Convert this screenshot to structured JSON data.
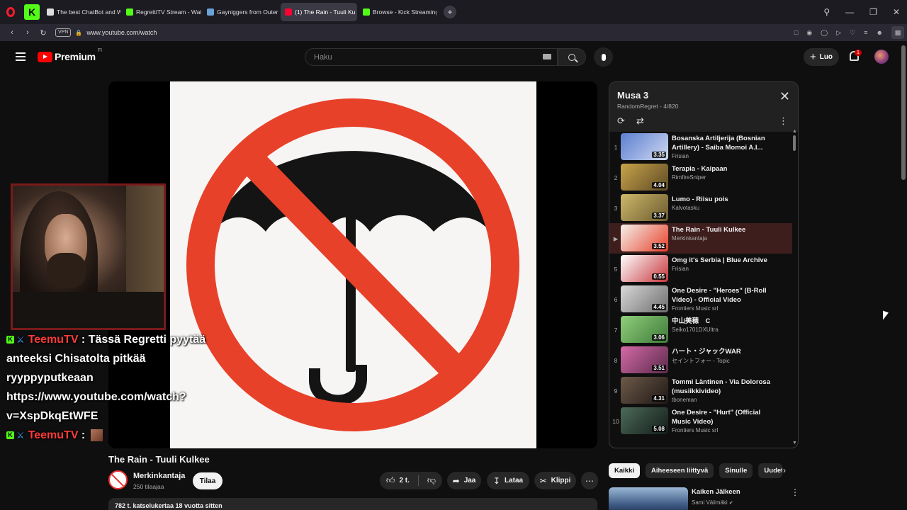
{
  "browser": {
    "tabs": [
      {
        "label": "The best ChatBot and Wid",
        "color": "#dddddd"
      },
      {
        "label": "RegrettiTV Stream - Watc",
        "color": "#53fc18"
      },
      {
        "label": "Gayniggers from Outer Sp",
        "color": "#6aa3d8"
      },
      {
        "label": "(1) The Rain - Tuuli Ku",
        "color": "#ff0033"
      },
      {
        "label": "Browse - Kick Streaming",
        "color": "#53fc18"
      }
    ],
    "url": "www.youtube.com/watch",
    "vpn_label": "VPN"
  },
  "youtube": {
    "brand": "Premium",
    "region": "FI",
    "search_placeholder": "Haku",
    "create_label": "Luo",
    "notifications": "1"
  },
  "chat": {
    "messages": [
      {
        "user": "TeemuTV",
        "text": "Tässä Regretti pyytää anteeksi Chisatolta pitkää ryyppyputkeaan https://www.youtube.com/watch?v=XspDkqEtWFE"
      },
      {
        "user": "TeemuTV",
        "text": ""
      }
    ]
  },
  "video": {
    "title": "The Rain - Tuuli Kulkee",
    "channel": "Merkinkantaja",
    "subscribers": "250 tilaajaa",
    "subscribe_label": "Tilaa",
    "likes": "2 t.",
    "share_label": "Jaa",
    "download_label": "Lataa",
    "clip_label": "Klippi",
    "views_line": "782 t. katselukertaa  18 vuotta sitten",
    "colors": {
      "ring": "#e8412a",
      "umbrella": "#141414"
    }
  },
  "playlist": {
    "title": "Musa 3",
    "subtitle": "RandomRegret - 4/820",
    "items": [
      {
        "index": "1",
        "title": "Bosanska Artiljerija (Bosnian Artillery) - Saiba Momoi A.I...",
        "channel": "Frisian",
        "duration": "3.35",
        "colors": [
          "#5b7fd1",
          "#cfd8f0"
        ]
      },
      {
        "index": "2",
        "title": "Terapia - Kaipaan",
        "channel": "RimfireSniper",
        "duration": "4.04",
        "colors": [
          "#c9a44a",
          "#5d4a25"
        ]
      },
      {
        "index": "3",
        "title": "Lumo - Riisu pois",
        "channel": "Kalvotasku",
        "duration": "3.37",
        "colors": [
          "#cdb86a",
          "#6a5a2e"
        ]
      },
      {
        "index": "▶",
        "title": "The Rain - Tuuli Kulkee",
        "channel": "Merkinkantaja",
        "duration": "3.52",
        "colors": [
          "#f4f1ec",
          "#e8412a"
        ],
        "active": true
      },
      {
        "index": "5",
        "title": "Omg it's Serbia | Blue Archive",
        "channel": "Frisian",
        "duration": "0.55",
        "colors": [
          "#ffffff",
          "#c6363c"
        ]
      },
      {
        "index": "6",
        "title": "One Desire - \"Heroes\" (B-Roll Video) - Official Video",
        "channel": "Frontiers Music srl",
        "duration": "4.45",
        "colors": [
          "#d9d9d9",
          "#6d6d6d"
        ]
      },
      {
        "index": "7",
        "title": "中山美穂　C",
        "channel": "Seiko1701DXUltra",
        "duration": "3.06",
        "colors": [
          "#8fcf7a",
          "#3f7a3a"
        ]
      },
      {
        "index": "8",
        "title": "ハート・ジャックWAR",
        "channel": "セイントフォー - Topic",
        "duration": "3.51",
        "colors": [
          "#d46aa8",
          "#5b2a4a"
        ]
      },
      {
        "index": "9",
        "title": "Tommi Läntinen - Via Dolorosa (musiikkivideo)",
        "channel": "tboneman",
        "duration": "4.31",
        "colors": [
          "#6d5a4a",
          "#1f1814"
        ]
      },
      {
        "index": "10",
        "title": "One Desire - \"Hurt\" (Official Music Video)",
        "channel": "Frontiers Music srl",
        "duration": "5.08",
        "colors": [
          "#4d6a5a",
          "#121c18"
        ]
      }
    ]
  },
  "chips": [
    "Kaikki",
    "Aiheeseen liittyvä",
    "Sinulle",
    "Uudet l"
  ],
  "related": {
    "title": "Kaiken Jälkeen",
    "channel": "Sami Välimäki"
  }
}
